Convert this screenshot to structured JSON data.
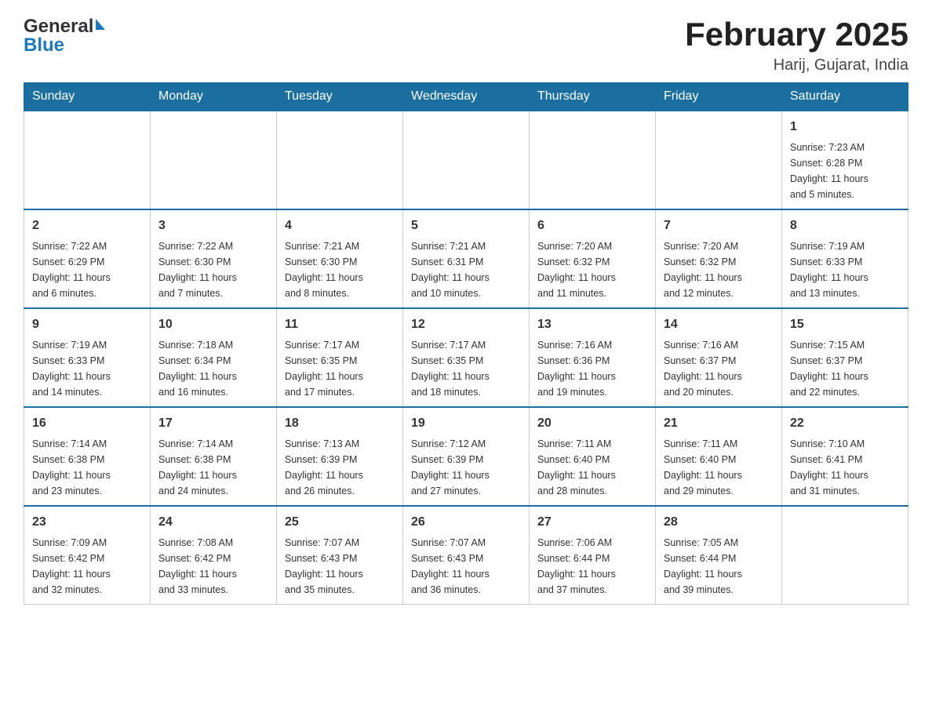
{
  "header": {
    "logo_general": "General",
    "logo_blue": "Blue",
    "month_title": "February 2025",
    "location": "Harij, Gujarat, India"
  },
  "days_of_week": [
    "Sunday",
    "Monday",
    "Tuesday",
    "Wednesday",
    "Thursday",
    "Friday",
    "Saturday"
  ],
  "weeks": [
    {
      "days": [
        {
          "num": "",
          "info": ""
        },
        {
          "num": "",
          "info": ""
        },
        {
          "num": "",
          "info": ""
        },
        {
          "num": "",
          "info": ""
        },
        {
          "num": "",
          "info": ""
        },
        {
          "num": "",
          "info": ""
        },
        {
          "num": "1",
          "info": "Sunrise: 7:23 AM\nSunset: 6:28 PM\nDaylight: 11 hours\nand 5 minutes."
        }
      ]
    },
    {
      "days": [
        {
          "num": "2",
          "info": "Sunrise: 7:22 AM\nSunset: 6:29 PM\nDaylight: 11 hours\nand 6 minutes."
        },
        {
          "num": "3",
          "info": "Sunrise: 7:22 AM\nSunset: 6:30 PM\nDaylight: 11 hours\nand 7 minutes."
        },
        {
          "num": "4",
          "info": "Sunrise: 7:21 AM\nSunset: 6:30 PM\nDaylight: 11 hours\nand 8 minutes."
        },
        {
          "num": "5",
          "info": "Sunrise: 7:21 AM\nSunset: 6:31 PM\nDaylight: 11 hours\nand 10 minutes."
        },
        {
          "num": "6",
          "info": "Sunrise: 7:20 AM\nSunset: 6:32 PM\nDaylight: 11 hours\nand 11 minutes."
        },
        {
          "num": "7",
          "info": "Sunrise: 7:20 AM\nSunset: 6:32 PM\nDaylight: 11 hours\nand 12 minutes."
        },
        {
          "num": "8",
          "info": "Sunrise: 7:19 AM\nSunset: 6:33 PM\nDaylight: 11 hours\nand 13 minutes."
        }
      ]
    },
    {
      "days": [
        {
          "num": "9",
          "info": "Sunrise: 7:19 AM\nSunset: 6:33 PM\nDaylight: 11 hours\nand 14 minutes."
        },
        {
          "num": "10",
          "info": "Sunrise: 7:18 AM\nSunset: 6:34 PM\nDaylight: 11 hours\nand 16 minutes."
        },
        {
          "num": "11",
          "info": "Sunrise: 7:17 AM\nSunset: 6:35 PM\nDaylight: 11 hours\nand 17 minutes."
        },
        {
          "num": "12",
          "info": "Sunrise: 7:17 AM\nSunset: 6:35 PM\nDaylight: 11 hours\nand 18 minutes."
        },
        {
          "num": "13",
          "info": "Sunrise: 7:16 AM\nSunset: 6:36 PM\nDaylight: 11 hours\nand 19 minutes."
        },
        {
          "num": "14",
          "info": "Sunrise: 7:16 AM\nSunset: 6:37 PM\nDaylight: 11 hours\nand 20 minutes."
        },
        {
          "num": "15",
          "info": "Sunrise: 7:15 AM\nSunset: 6:37 PM\nDaylight: 11 hours\nand 22 minutes."
        }
      ]
    },
    {
      "days": [
        {
          "num": "16",
          "info": "Sunrise: 7:14 AM\nSunset: 6:38 PM\nDaylight: 11 hours\nand 23 minutes."
        },
        {
          "num": "17",
          "info": "Sunrise: 7:14 AM\nSunset: 6:38 PM\nDaylight: 11 hours\nand 24 minutes."
        },
        {
          "num": "18",
          "info": "Sunrise: 7:13 AM\nSunset: 6:39 PM\nDaylight: 11 hours\nand 26 minutes."
        },
        {
          "num": "19",
          "info": "Sunrise: 7:12 AM\nSunset: 6:39 PM\nDaylight: 11 hours\nand 27 minutes."
        },
        {
          "num": "20",
          "info": "Sunrise: 7:11 AM\nSunset: 6:40 PM\nDaylight: 11 hours\nand 28 minutes."
        },
        {
          "num": "21",
          "info": "Sunrise: 7:11 AM\nSunset: 6:40 PM\nDaylight: 11 hours\nand 29 minutes."
        },
        {
          "num": "22",
          "info": "Sunrise: 7:10 AM\nSunset: 6:41 PM\nDaylight: 11 hours\nand 31 minutes."
        }
      ]
    },
    {
      "days": [
        {
          "num": "23",
          "info": "Sunrise: 7:09 AM\nSunset: 6:42 PM\nDaylight: 11 hours\nand 32 minutes."
        },
        {
          "num": "24",
          "info": "Sunrise: 7:08 AM\nSunset: 6:42 PM\nDaylight: 11 hours\nand 33 minutes."
        },
        {
          "num": "25",
          "info": "Sunrise: 7:07 AM\nSunset: 6:43 PM\nDaylight: 11 hours\nand 35 minutes."
        },
        {
          "num": "26",
          "info": "Sunrise: 7:07 AM\nSunset: 6:43 PM\nDaylight: 11 hours\nand 36 minutes."
        },
        {
          "num": "27",
          "info": "Sunrise: 7:06 AM\nSunset: 6:44 PM\nDaylight: 11 hours\nand 37 minutes."
        },
        {
          "num": "28",
          "info": "Sunrise: 7:05 AM\nSunset: 6:44 PM\nDaylight: 11 hours\nand 39 minutes."
        },
        {
          "num": "",
          "info": ""
        }
      ]
    }
  ]
}
